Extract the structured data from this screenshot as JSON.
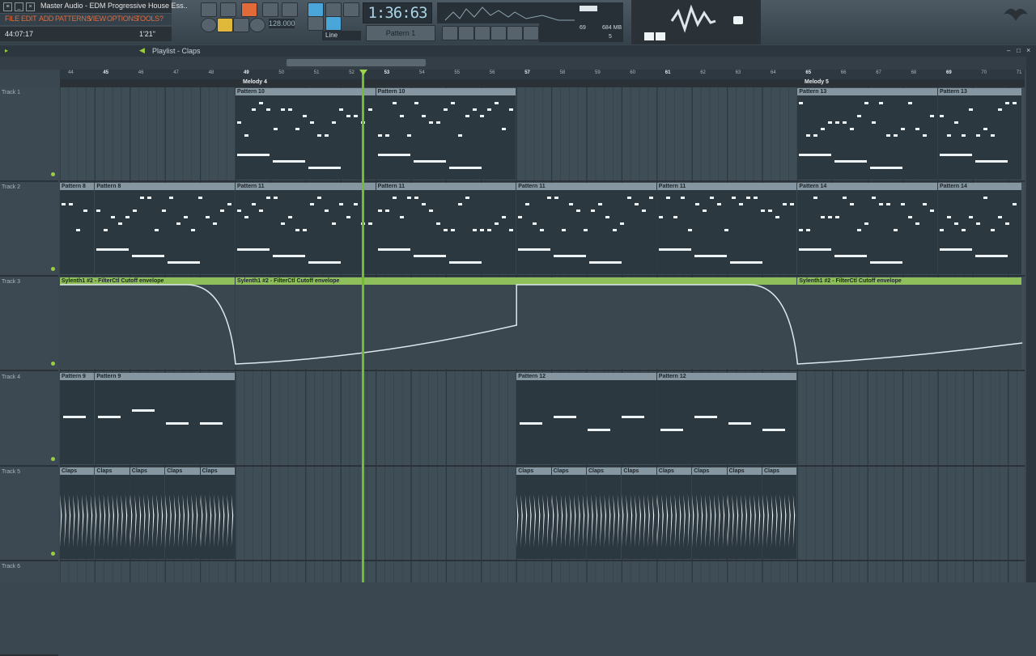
{
  "window": {
    "title": "Master Audio - EDM Progressive House Ess..",
    "hint_left": "44:07:17",
    "hint_right": "1'21\""
  },
  "menu": [
    "FILE",
    "EDIT",
    "ADD",
    "PATTERNS",
    "VIEW",
    "OPTIONS",
    "TOOLS",
    "?"
  ],
  "transport": {
    "time": "1:36:63",
    "tempo": "128.000",
    "pattern": "Pattern 1",
    "mode": "Line",
    "cpu": "69",
    "ram": "684 MB",
    "poly": "5"
  },
  "playlist": {
    "title": "Playlist - Claps"
  },
  "bars": [
    "44",
    "45",
    "46",
    "47",
    "48",
    "49",
    "50",
    "51",
    "52",
    "53",
    "54",
    "55",
    "56",
    "57",
    "58",
    "59",
    "60",
    "61",
    "62",
    "63",
    "64",
    "65",
    "66",
    "67",
    "68",
    "69",
    "70",
    "71"
  ],
  "markers": [
    "Melody 4",
    "Melody 5"
  ],
  "tracks": [
    "Track 1",
    "Track 2",
    "Track 3",
    "Track 4",
    "Track 5",
    "Track 6"
  ],
  "clips": {
    "pattern10": "Pattern 10",
    "pattern13": "Pattern 13",
    "pattern8": "Pattern 8",
    "pattern11": "Pattern 11",
    "pattern14": "Pattern 14",
    "envelope": "Sylenth1 #2 - FilterCtl Cutoff envelope",
    "pattern9": "Pattern 9",
    "pattern12": "Pattern 12",
    "claps": "Claps"
  },
  "colors": {
    "accent": "#e06a3a",
    "playhead": "#6fbf2a",
    "automation": "#8fbf5a"
  }
}
